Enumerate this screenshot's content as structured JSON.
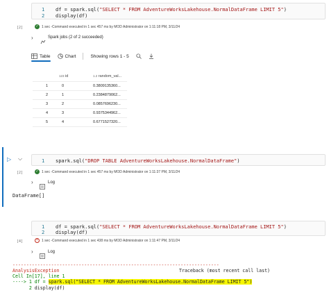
{
  "cell1": {
    "lines": [
      {
        "num": "1",
        "code_a": "df = spark.sql(",
        "code_str": "\"SELECT * FROM AdventureWorksLakehouse.NormalDataFrame LIMIT 5\"",
        "code_b": ")"
      },
      {
        "num": "2",
        "code_a": "display(df)",
        "code_str": "",
        "code_b": ""
      }
    ],
    "exec_label": "[2]",
    "status": "1 sec -Command executed in 1 sec 457 ms by MOD Administrator on 1:11:18 PM, 3/11/24",
    "spark_jobs": "Spark jobs (2 of 2 succeeded)"
  },
  "toolbar": {
    "table_label": "Table",
    "chart_label": "Chart",
    "rows_label": "Showing rows 1 - 5"
  },
  "grid": {
    "columns": [
      {
        "type": "123",
        "name": "id"
      },
      {
        "type": "1.2",
        "name": "random_val..."
      }
    ],
    "rows": [
      {
        "index": "1",
        "id": "0",
        "val": "0.3809135360..."
      },
      {
        "index": "2",
        "id": "1",
        "val": "0.2384879062..."
      },
      {
        "index": "3",
        "id": "2",
        "val": "0.0857696230..."
      },
      {
        "index": "4",
        "id": "3",
        "val": "0.9375344962..."
      },
      {
        "index": "5",
        "id": "4",
        "val": "0.6771527320..."
      }
    ]
  },
  "cell2": {
    "num": "1",
    "code_a": "spark.sql(",
    "code_str": "\"DROP TABLE AdventureWorksLakehouse.NormalDataFrame\"",
    "code_b": ")",
    "exec_label": "[2]",
    "status": "1 sec -Command executed in 1 sec 457 ms by MOD Administrator on 1:11:37 PM, 3/11/24",
    "log_label": "Log",
    "output": "DataFrame[]"
  },
  "cell3": {
    "lines": [
      {
        "num": "1",
        "code_a": "df = spark.sql(",
        "code_str": "\"SELECT * FROM AdventureWorksLakehouse.NormalDataFrame LIMIT 5\"",
        "code_b": ")"
      },
      {
        "num": "2",
        "code_a": "display(df)",
        "code_str": "",
        "code_b": ""
      }
    ],
    "exec_label": "[4]",
    "status": "1 sec -Command executed in 1 sec 438 ms by MOD Administrator on 1:11:47 PM, 3/11/24",
    "log_label": "Log"
  },
  "error": {
    "dashes": "---------------------------------------------------------------------------",
    "exception": "AnalysisException",
    "traceback": "Traceback (most recent call last)",
    "cell_ref": "Cell In[17], line 1",
    "arrow": "----> 1 df = ",
    "highlight": "spark.sql(\"SELECT * FROM AdventureWorksLakehouse.NormalDataFrame LIMIT 5\")",
    "line2_num": "2",
    "line2": "display(df)"
  },
  "colors": {
    "accent": "#0f6cbd",
    "error": "#c42b1c",
    "success": "#2e7d32",
    "highlight": "#f5f500"
  }
}
